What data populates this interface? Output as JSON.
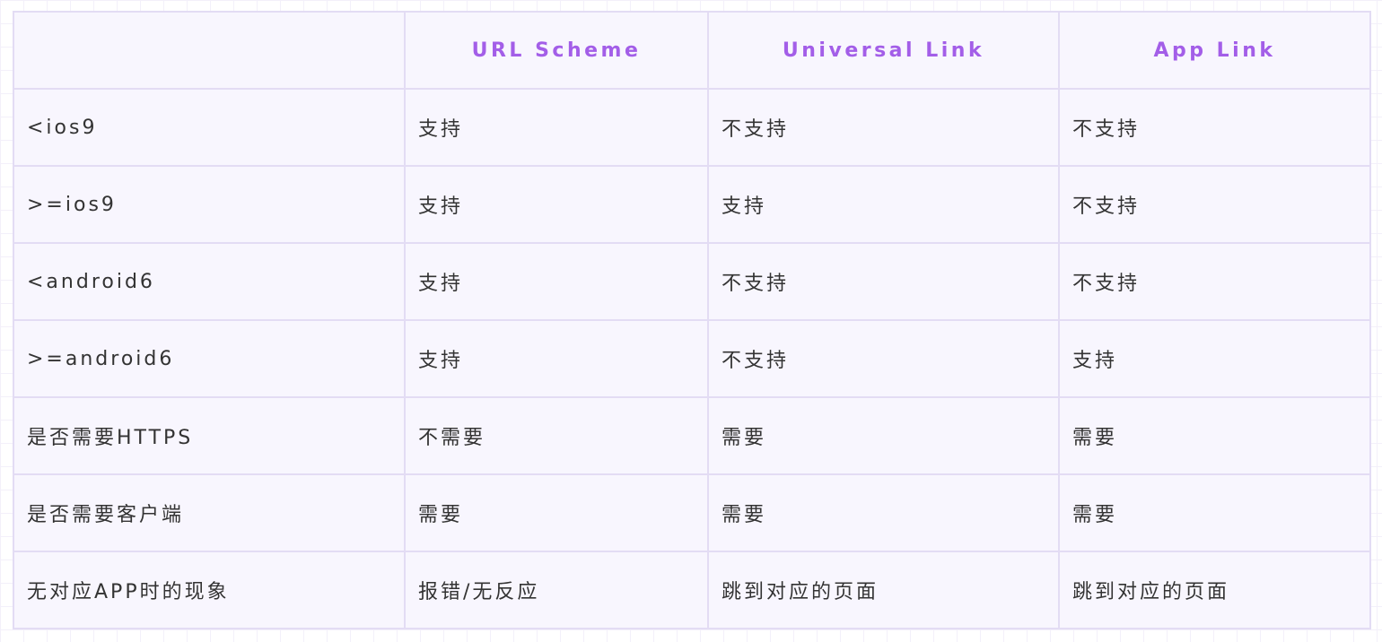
{
  "table": {
    "headers": [
      "",
      "URL Scheme",
      "Universal Link",
      "App Link"
    ],
    "rows": [
      [
        "<ios9",
        "支持",
        "不支持",
        "不支持"
      ],
      [
        ">=ios9",
        "支持",
        "支持",
        "不支持"
      ],
      [
        "<android6",
        "支持",
        "不支持",
        "不支持"
      ],
      [
        ">=android6",
        "支持",
        "不支持",
        "支持"
      ],
      [
        "是否需要HTTPS",
        "不需要",
        "需要",
        "需要"
      ],
      [
        "是否需要客户端",
        "需要",
        "需要",
        "需要"
      ],
      [
        "无对应APP时的现象",
        "报错/无反应",
        "跳到对应的页面",
        "跳到对应的页面"
      ]
    ]
  }
}
